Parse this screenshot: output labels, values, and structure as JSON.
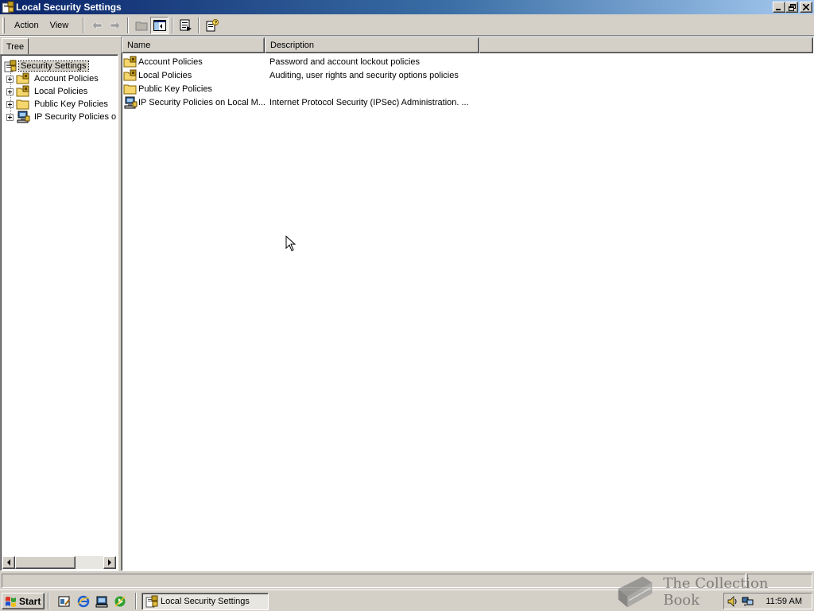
{
  "window": {
    "title": "Local Security Settings"
  },
  "menu": {
    "action": "Action",
    "view": "View"
  },
  "left_pane": {
    "tab_label": "Tree",
    "tree": {
      "root": {
        "label": "Security Settings",
        "icon": "security-settings-icon"
      },
      "children": [
        {
          "label": "Account Policies",
          "icon": "locked-folder-icon"
        },
        {
          "label": "Local Policies",
          "icon": "locked-folder-icon"
        },
        {
          "label": "Public Key Policies",
          "icon": "folder-icon"
        },
        {
          "label": "IP Security Policies on Local Machine",
          "icon": "ip-security-icon"
        }
      ]
    }
  },
  "list": {
    "columns": [
      "Name",
      "Description"
    ],
    "rows": [
      {
        "name": "Account Policies",
        "description": "Password and account lockout policies",
        "icon": "locked-folder-icon"
      },
      {
        "name": "Local Policies",
        "description": "Auditing, user rights and security options policies",
        "icon": "locked-folder-icon"
      },
      {
        "name": "Public Key Policies",
        "description": "",
        "icon": "folder-icon"
      },
      {
        "name": "IP Security Policies on Local M...",
        "description": "Internet Protocol Security (IPSec) Administration. ...",
        "icon": "ip-security-icon"
      }
    ]
  },
  "taskbar": {
    "start_label": "Start",
    "task_label": "Local Security Settings",
    "clock": "11:59 AM"
  },
  "watermark": "The Collection Book",
  "colors": {
    "title_start": "#0a246a",
    "title_end": "#a6caf0",
    "face": "#d4d0c8",
    "folder": "#f5d76e"
  }
}
